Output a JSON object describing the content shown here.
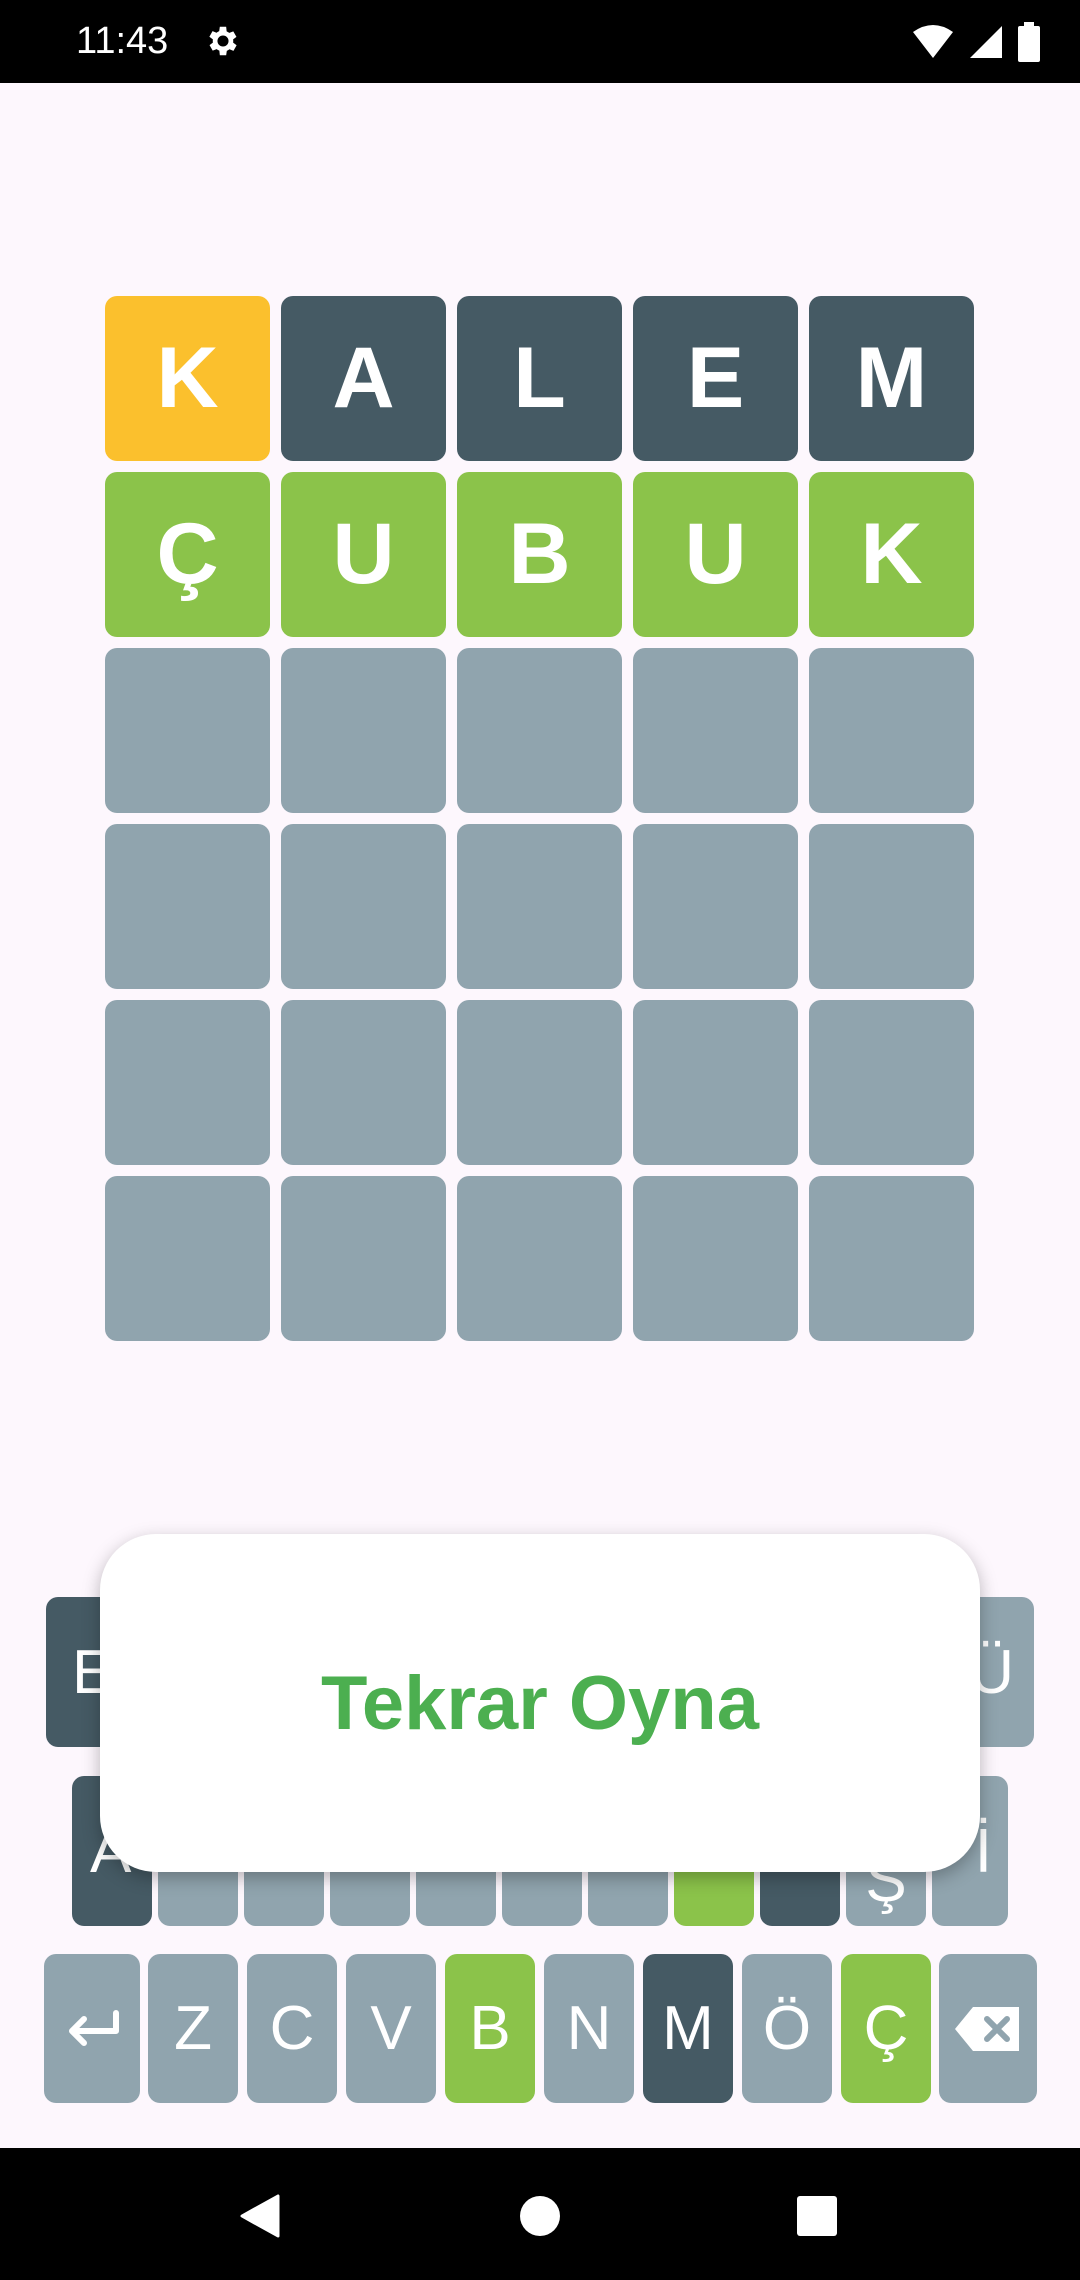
{
  "status_bar": {
    "time": "11:43"
  },
  "board": {
    "rows": [
      {
        "letters": [
          "K",
          "A",
          "L",
          "E",
          "M"
        ],
        "states": [
          "yellow",
          "dark",
          "dark",
          "dark",
          "dark"
        ]
      },
      {
        "letters": [
          "Ç",
          "U",
          "B",
          "U",
          "K"
        ],
        "states": [
          "green",
          "green",
          "green",
          "green",
          "green"
        ]
      },
      {
        "letters": [
          "",
          "",
          "",
          "",
          ""
        ],
        "states": [
          "empty",
          "empty",
          "empty",
          "empty",
          "empty"
        ]
      },
      {
        "letters": [
          "",
          "",
          "",
          "",
          ""
        ],
        "states": [
          "empty",
          "empty",
          "empty",
          "empty",
          "empty"
        ]
      },
      {
        "letters": [
          "",
          "",
          "",
          "",
          ""
        ],
        "states": [
          "empty",
          "empty",
          "empty",
          "empty",
          "empty"
        ]
      },
      {
        "letters": [
          "",
          "",
          "",
          "",
          ""
        ],
        "states": [
          "empty",
          "empty",
          "empty",
          "empty",
          "empty"
        ]
      }
    ]
  },
  "keyboard": {
    "row1_visible": {
      "left": "E",
      "right": "Ü"
    },
    "row2_visible": {
      "left": "A",
      "right": "İ",
      "partial": "Ş"
    },
    "row3": [
      "Z",
      "C",
      "V",
      "B",
      "N",
      "M",
      "Ö",
      "Ç"
    ],
    "row3_states": [
      "gray",
      "gray",
      "gray",
      "green",
      "gray",
      "dark",
      "gray",
      "green"
    ],
    "enter_icon": "enter-icon",
    "backspace_icon": "backspace-icon"
  },
  "dialog": {
    "button_label": "Tekrar Oyna"
  },
  "colors": {
    "yellow": "#fbc02d",
    "dark": "#455a64",
    "green": "#8bc34a",
    "empty": "#90a4ae",
    "accent": "#4caf50"
  }
}
